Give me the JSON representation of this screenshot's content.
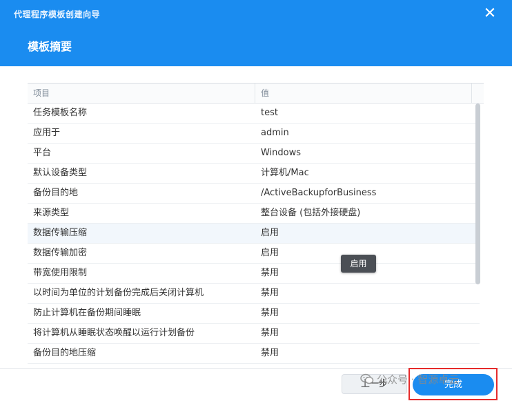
{
  "window": {
    "title": "代理程序模板创建向导"
  },
  "section": {
    "title": "模板摘要"
  },
  "table": {
    "headers": [
      "项目",
      "值"
    ],
    "rows": [
      {
        "item": "任务模板名称",
        "value": "test"
      },
      {
        "item": "应用于",
        "value": "admin"
      },
      {
        "item": "平台",
        "value": "Windows"
      },
      {
        "item": "默认设备类型",
        "value": "计算机/Mac"
      },
      {
        "item": "备份目的地",
        "value": "/ActiveBackupforBusiness"
      },
      {
        "item": "来源类型",
        "value": "整台设备 (包括外接硬盘)"
      },
      {
        "item": "数据传输压缩",
        "value": "启用"
      },
      {
        "item": "数据传输加密",
        "value": "启用"
      },
      {
        "item": "带宽使用限制",
        "value": "禁用"
      },
      {
        "item": "以时间为单位的计划备份完成后关闭计算机",
        "value": "禁用"
      },
      {
        "item": "防止计算机在备份期间睡眠",
        "value": "禁用"
      },
      {
        "item": "将计算机从睡眠状态唤醒以运行计划备份",
        "value": "禁用"
      },
      {
        "item": "备份目的地压缩",
        "value": "禁用"
      }
    ]
  },
  "tooltip": {
    "text": "启用"
  },
  "footer": {
    "prev_label": "上一步",
    "finish_label": "完成"
  },
  "watermark": {
    "text": "公众号 · 智源卓云"
  },
  "colors": {
    "accent": "#1a8cf0",
    "highlight_box": "#e52b2b"
  }
}
